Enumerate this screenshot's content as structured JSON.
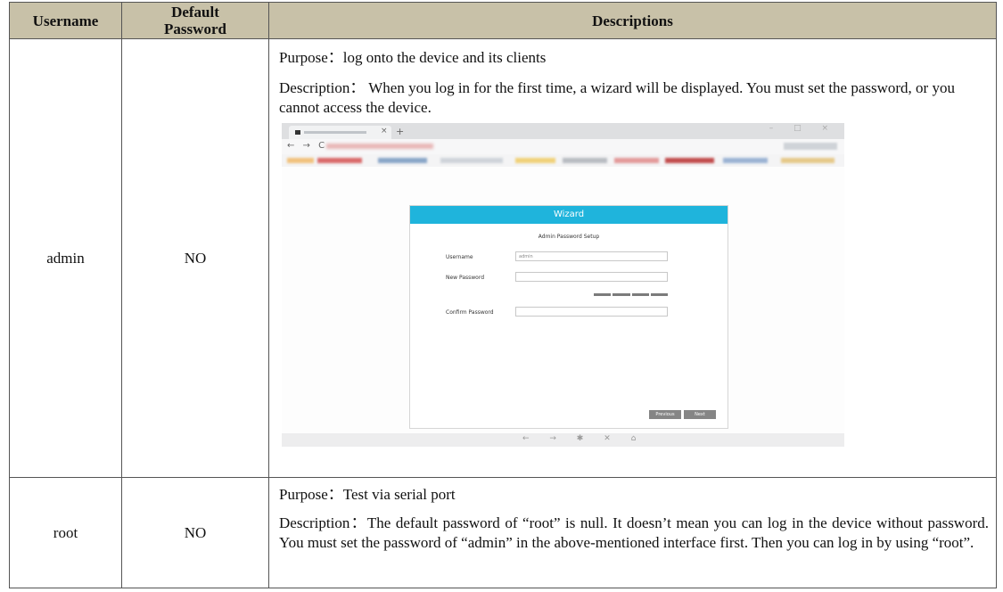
{
  "table": {
    "headers": [
      "Username",
      "Default Password",
      "Descriptions"
    ],
    "rows": [
      {
        "username": "admin",
        "default_password": "NO",
        "purpose": "Purpose：log onto the device and its clients",
        "description": "Description： When you log in for the first time, a wizard will be displayed. You must set the password, or you cannot access the device."
      },
      {
        "username": "root",
        "default_password": "NO",
        "purpose": "Purpose：Test via serial port",
        "description": "Description：The default password of “root” is null. It doesn’t mean you can log in the device without password. You must set the password of “admin” in the above-mentioned interface first. Then you can log in by using “root”."
      }
    ]
  },
  "screenshot": {
    "wizard": {
      "title": "Wizard",
      "subtitle": "Admin Password Setup",
      "fields": [
        {
          "label": "Username",
          "value": "admin"
        },
        {
          "label": "New Password",
          "value": ""
        },
        {
          "label": "Confirm Password",
          "value": ""
        }
      ],
      "previous_label": "Previous",
      "next_label": "Next"
    },
    "colors": {
      "wizard_header": "#1fb4dc",
      "table_header": "#c8c1a8"
    }
  }
}
